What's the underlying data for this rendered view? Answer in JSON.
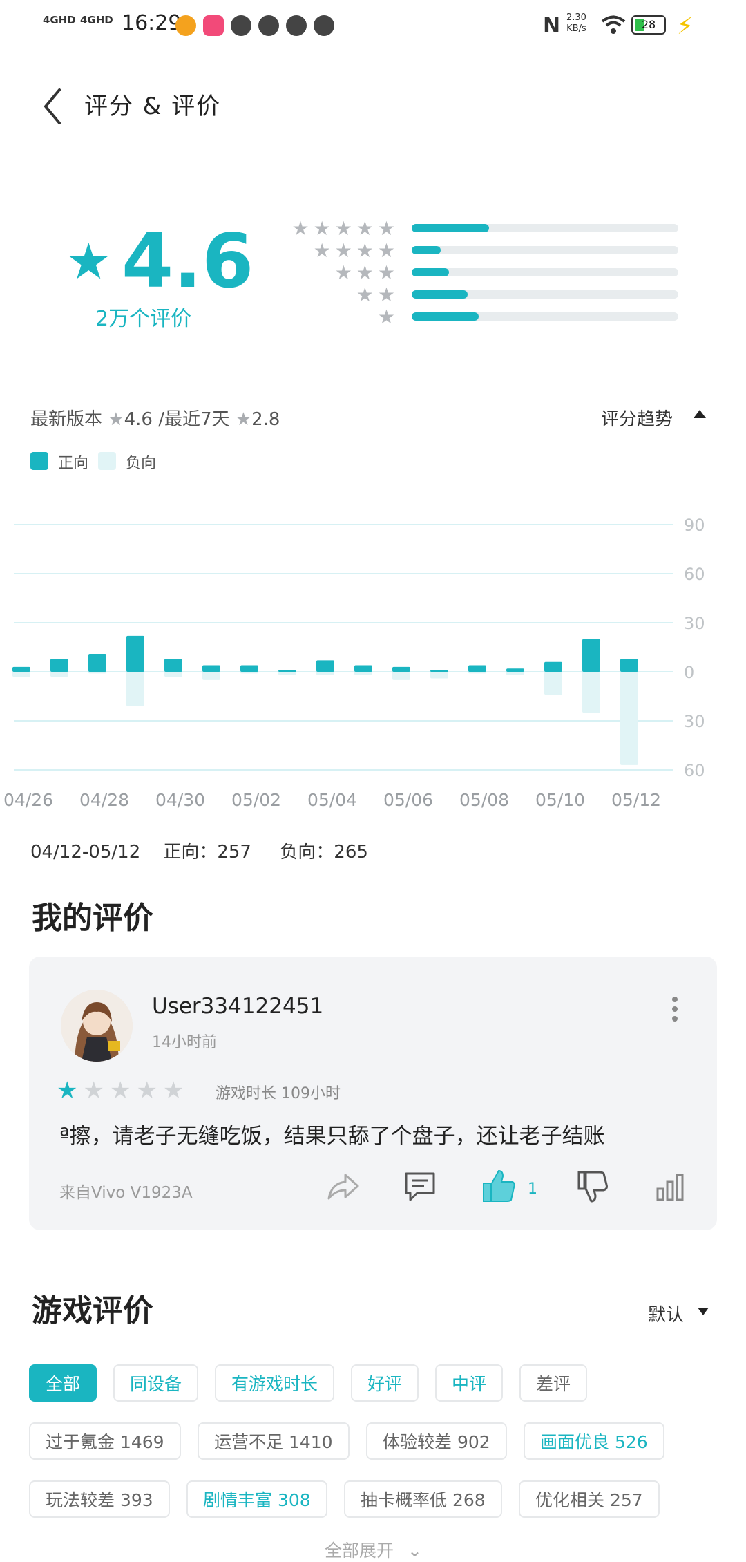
{
  "status_bar": {
    "signal1": "4GHD",
    "signal2": "4GHD",
    "time": "16:29",
    "net_speed_value": "2.30",
    "net_speed_unit": "KB/s",
    "battery": "28"
  },
  "header": {
    "title": "评分 & 评价"
  },
  "rating": {
    "score": "4.6",
    "count_label": "2万个评价",
    "distribution": [
      {
        "stars": 5,
        "fraction": 0.29
      },
      {
        "stars": 4,
        "fraction": 0.11
      },
      {
        "stars": 3,
        "fraction": 0.14
      },
      {
        "stars": 2,
        "fraction": 0.21
      },
      {
        "stars": 1,
        "fraction": 0.25
      }
    ]
  },
  "version_line": {
    "label_latest": "最新版本",
    "latest_score": "4.6",
    "sep_recent": "/最近7天",
    "recent_score": "2.8",
    "trend_label": "评分趋势"
  },
  "legend": {
    "positive": "正向",
    "negative": "负向"
  },
  "colors": {
    "accent": "#1ab5c1",
    "negative": "#e1f4f6",
    "grid": "#d7f1f4"
  },
  "chart_data": {
    "type": "bar",
    "x_labels": [
      "04/26",
      "04/28",
      "04/30",
      "05/02",
      "05/04",
      "05/06",
      "05/08",
      "05/10",
      "05/12"
    ],
    "y_ticks": [
      "90",
      "60",
      "30",
      "0",
      "30",
      "60"
    ],
    "ylim": [
      -60,
      90
    ],
    "series": [
      {
        "name": "正向",
        "values": [
          3,
          8,
          11,
          22,
          8,
          4,
          4,
          1,
          7,
          4,
          3,
          1,
          4,
          2,
          6,
          20,
          8
        ]
      },
      {
        "name": "负向",
        "values": [
          -3,
          -3,
          -1,
          -21,
          -3,
          -5,
          -1,
          -2,
          -2,
          -2,
          -5,
          -4,
          -1,
          -2,
          -14,
          -25,
          -57
        ]
      }
    ]
  },
  "summary": {
    "range": "04/12-05/12",
    "positive_label": "正向：257",
    "negative_label": "负向：265"
  },
  "my_review": {
    "section_title": "我的评价",
    "username": "User334122451",
    "time_ago": "14小时前",
    "stars_filled": 1,
    "playtime": "游戏时长 109小时",
    "text": "ª擦，请老子无缝吃饭，结果只舔了个盘子，还让老子结账",
    "device": "来自Vivo V1923A",
    "like_count": "1"
  },
  "game_reviews": {
    "section_title": "游戏评价",
    "sort_label": "默认",
    "filters": [
      "全部",
      "同设备",
      "有游戏时长",
      "好评",
      "中评",
      "差评"
    ],
    "tags_row1": [
      {
        "label": "过于氪金 1469",
        "teal": false
      },
      {
        "label": "运营不足 1410",
        "teal": false
      },
      {
        "label": "体验较差 902",
        "teal": false
      },
      {
        "label": "画面优良 526",
        "teal": true
      }
    ],
    "tags_row2": [
      {
        "label": "玩法较差 393",
        "teal": false
      },
      {
        "label": "剧情丰富 308",
        "teal": true
      },
      {
        "label": "抽卡概率低 268",
        "teal": false
      },
      {
        "label": "优化相关 257",
        "teal": false
      }
    ],
    "expand_label": "全部展开"
  }
}
